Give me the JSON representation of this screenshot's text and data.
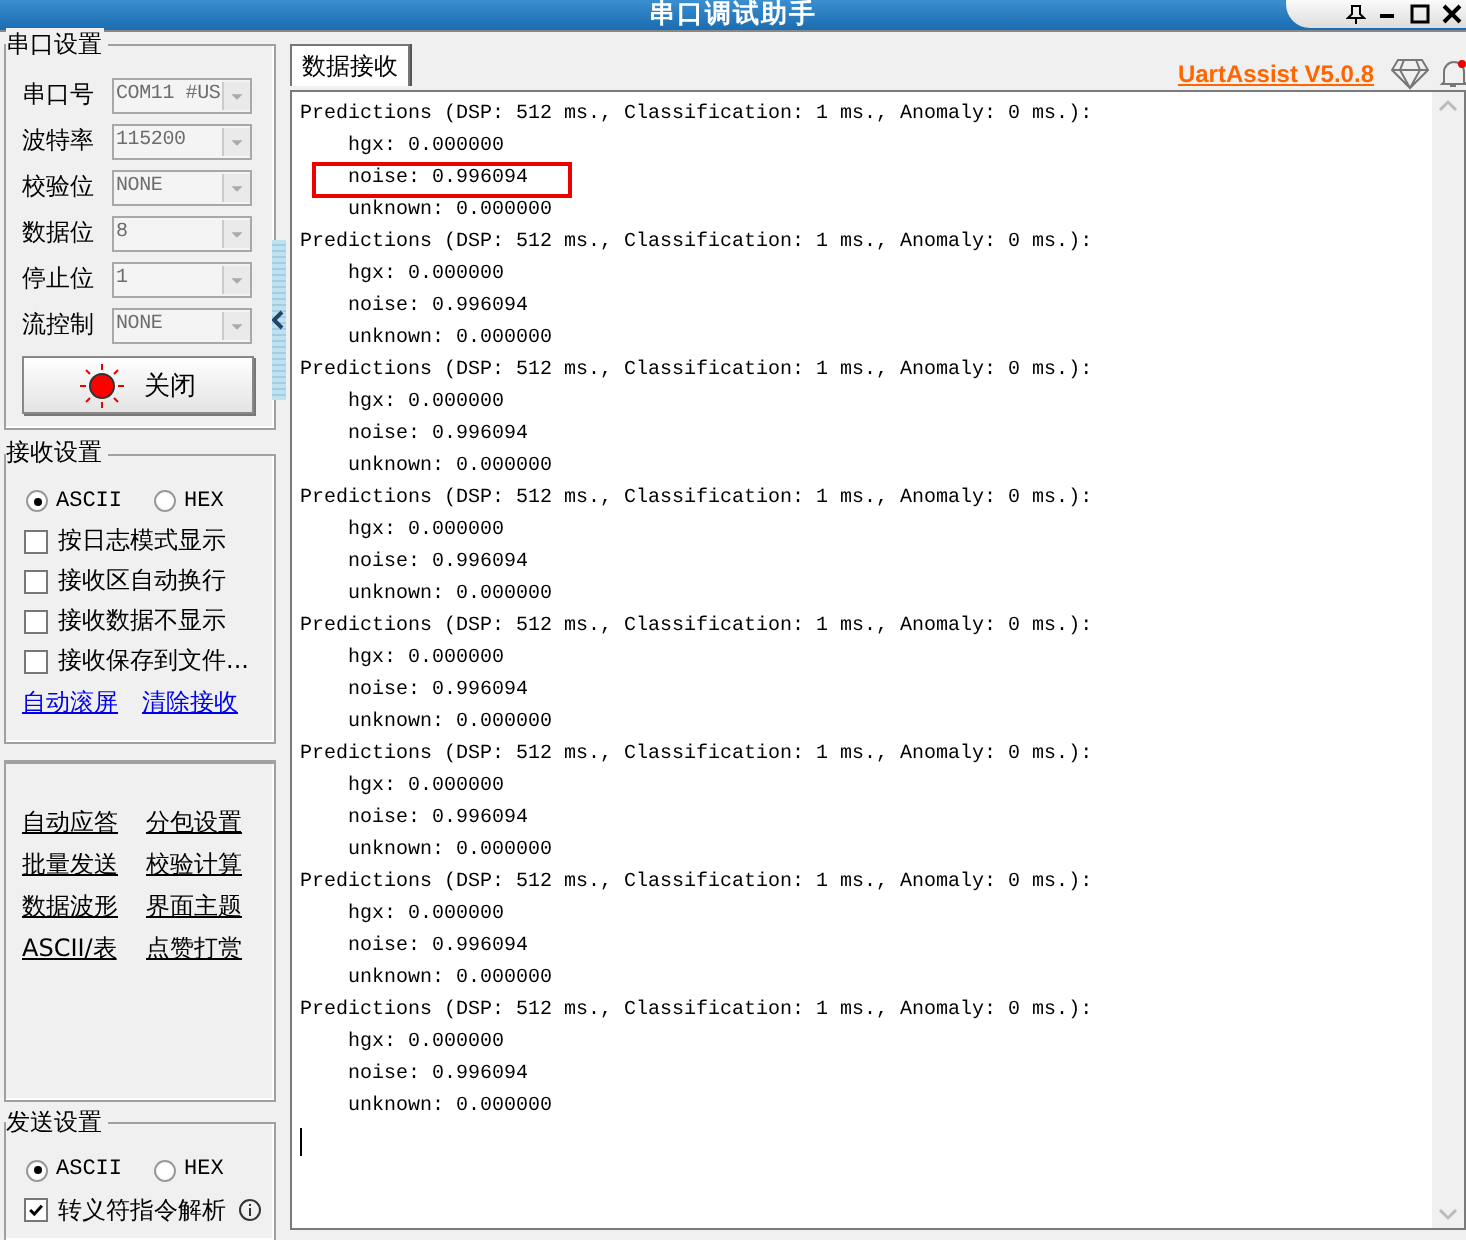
{
  "window": {
    "title": "串口调试助手"
  },
  "serial_settings": {
    "title": "串口设置",
    "fields": [
      {
        "label": "串口号",
        "value": "COM11 #US",
        "disabled": true
      },
      {
        "label": "波特率",
        "value": "115200",
        "disabled": true
      },
      {
        "label": "校验位",
        "value": "NONE",
        "disabled": true
      },
      {
        "label": "数据位",
        "value": "8",
        "disabled": true
      },
      {
        "label": "停止位",
        "value": "1",
        "disabled": true
      },
      {
        "label": "流控制",
        "value": "NONE",
        "disabled": true
      }
    ],
    "open_button": {
      "label": "关闭",
      "on": true
    }
  },
  "receive_settings": {
    "title": "接收设置",
    "modes": [
      {
        "label": "ASCII",
        "selected": true
      },
      {
        "label": "HEX",
        "selected": false
      }
    ],
    "options": [
      {
        "label": "按日志模式显示",
        "checked": false
      },
      {
        "label": "接收区自动换行",
        "checked": false
      },
      {
        "label": "接收数据不显示",
        "checked": false
      },
      {
        "label": "接收保存到文件...",
        "checked": false
      }
    ],
    "links": [
      "自动滚屏",
      "清除接收"
    ]
  },
  "tools": [
    "自动应答",
    "分包设置",
    "批量发送",
    "校验计算",
    "数据波形",
    "界面主题",
    "ASCII/表",
    "点赞打赏"
  ],
  "send_settings": {
    "title": "发送设置",
    "modes": [
      {
        "label": "ASCII",
        "selected": true
      },
      {
        "label": "HEX",
        "selected": false
      }
    ],
    "options": [
      {
        "label": "转义符指令解析",
        "checked": true
      }
    ]
  },
  "tabs": [
    {
      "label": "数据接收",
      "selected": true
    }
  ],
  "brand_link": "UartAssist V5.0.8",
  "log": [
    {
      "kind": "header",
      "text": "Predictions (DSP: 512 ms., Classification: 1 ms., Anomaly: 0 ms.):",
      "highlighted": false
    },
    {
      "kind": "value",
      "text": "hgx: 0.000000",
      "highlighted": false
    },
    {
      "kind": "value",
      "text": "noise: 0.996094",
      "highlighted": true
    },
    {
      "kind": "value",
      "text": "unknown: 0.000000",
      "highlighted": false
    },
    {
      "kind": "header",
      "text": "Predictions (DSP: 512 ms., Classification: 1 ms., Anomaly: 0 ms.):",
      "highlighted": false
    },
    {
      "kind": "value",
      "text": "hgx: 0.000000",
      "highlighted": false
    },
    {
      "kind": "value",
      "text": "noise: 0.996094",
      "highlighted": false
    },
    {
      "kind": "value",
      "text": "unknown: 0.000000",
      "highlighted": false
    },
    {
      "kind": "header",
      "text": "Predictions (DSP: 512 ms., Classification: 1 ms., Anomaly: 0 ms.):",
      "highlighted": false
    },
    {
      "kind": "value",
      "text": "hgx: 0.000000",
      "highlighted": false
    },
    {
      "kind": "value",
      "text": "noise: 0.996094",
      "highlighted": false
    },
    {
      "kind": "value",
      "text": "unknown: 0.000000",
      "highlighted": false
    },
    {
      "kind": "header",
      "text": "Predictions (DSP: 512 ms., Classification: 1 ms., Anomaly: 0 ms.):",
      "highlighted": false
    },
    {
      "kind": "value",
      "text": "hgx: 0.000000",
      "highlighted": false
    },
    {
      "kind": "value",
      "text": "noise: 0.996094",
      "highlighted": false
    },
    {
      "kind": "value",
      "text": "unknown: 0.000000",
      "highlighted": false
    },
    {
      "kind": "header",
      "text": "Predictions (DSP: 512 ms., Classification: 1 ms., Anomaly: 0 ms.):",
      "highlighted": false
    },
    {
      "kind": "value",
      "text": "hgx: 0.000000",
      "highlighted": false
    },
    {
      "kind": "value",
      "text": "noise: 0.996094",
      "highlighted": false
    },
    {
      "kind": "value",
      "text": "unknown: 0.000000",
      "highlighted": false
    },
    {
      "kind": "header",
      "text": "Predictions (DSP: 512 ms., Classification: 1 ms., Anomaly: 0 ms.):",
      "highlighted": false
    },
    {
      "kind": "value",
      "text": "hgx: 0.000000",
      "highlighted": false
    },
    {
      "kind": "value",
      "text": "noise: 0.996094",
      "highlighted": false
    },
    {
      "kind": "value",
      "text": "unknown: 0.000000",
      "highlighted": false
    },
    {
      "kind": "header",
      "text": "Predictions (DSP: 512 ms., Classification: 1 ms., Anomaly: 0 ms.):",
      "highlighted": false
    },
    {
      "kind": "value",
      "text": "hgx: 0.000000",
      "highlighted": false
    },
    {
      "kind": "value",
      "text": "noise: 0.996094",
      "highlighted": false
    },
    {
      "kind": "value",
      "text": "unknown: 0.000000",
      "highlighted": false
    },
    {
      "kind": "header",
      "text": "Predictions (DSP: 512 ms., Classification: 1 ms., Anomaly: 0 ms.):",
      "highlighted": false
    },
    {
      "kind": "value",
      "text": "hgx: 0.000000",
      "highlighted": false
    },
    {
      "kind": "value",
      "text": "noise: 0.996094",
      "highlighted": false
    },
    {
      "kind": "value",
      "text": "unknown: 0.000000",
      "highlighted": false
    }
  ]
}
